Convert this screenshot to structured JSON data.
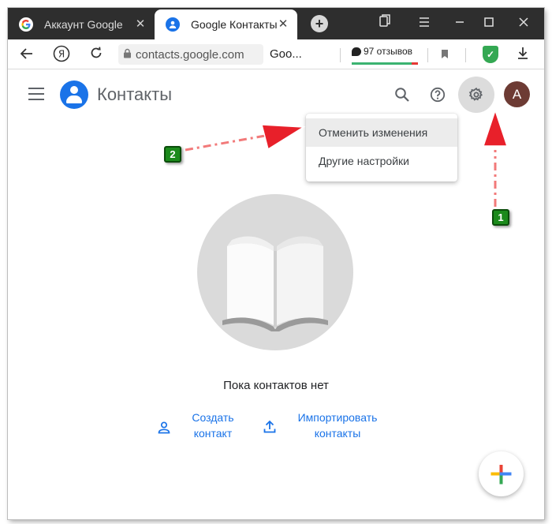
{
  "browser": {
    "tabs": [
      {
        "label": "Аккаунт Google",
        "active": false
      },
      {
        "label": "Google Контакты",
        "active": true
      }
    ],
    "url": "contacts.google.com",
    "page_title": "Goo...",
    "reviews": "97 отзывов"
  },
  "app": {
    "title": "Контакты",
    "avatar_letter": "A",
    "menu": {
      "items": [
        {
          "label": "Отменить изменения",
          "highlighted": true
        },
        {
          "label": "Другие настройки",
          "highlighted": false
        }
      ]
    },
    "empty_text": "Пока контактов нет",
    "actions": {
      "create": {
        "line1": "Создать",
        "line2": "контакт"
      },
      "import": {
        "line1": "Импортировать",
        "line2": "контакты"
      }
    }
  },
  "annotations": {
    "badge1": "1",
    "badge2": "2"
  },
  "colors": {
    "accent": "#1a73e8",
    "arrow": "#e8202a",
    "badge": "#1b8a1b"
  }
}
